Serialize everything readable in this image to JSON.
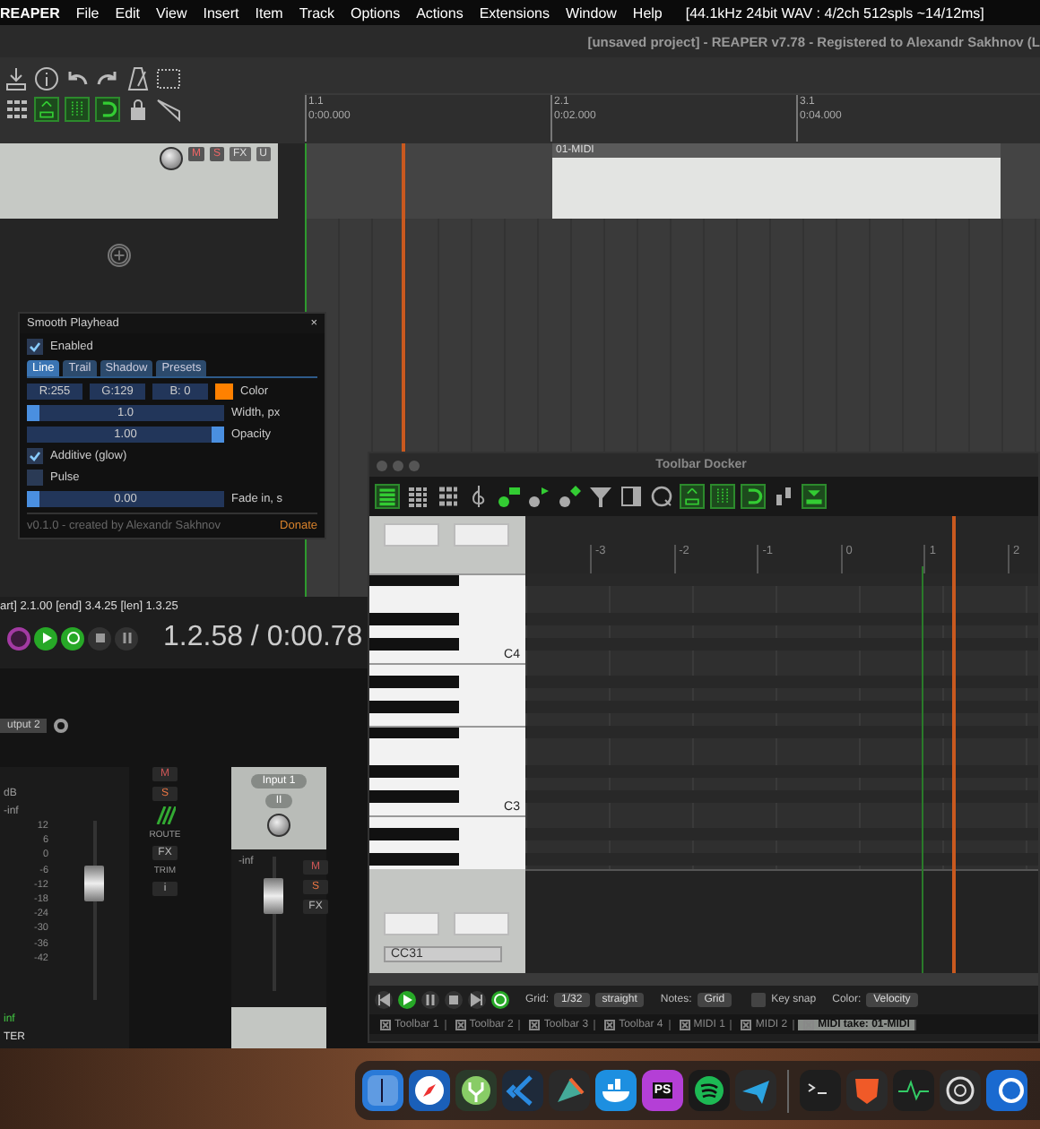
{
  "menubar": {
    "app": "REAPER",
    "items": [
      "File",
      "Edit",
      "View",
      "Insert",
      "Item",
      "Track",
      "Options",
      "Actions",
      "Extensions",
      "Window",
      "Help"
    ],
    "status": "[44.1kHz 24bit WAV : 4/2ch 512spls ~14/12ms]"
  },
  "main_window": {
    "title": "[unsaved project] - REAPER v7.78 - Registered to Alexandr Sakhnov (L",
    "ruler": [
      {
        "bar": "1.1",
        "time": "0:00.000"
      },
      {
        "bar": "2.1",
        "time": "0:02.000"
      },
      {
        "bar": "3.1",
        "time": "0:04.000"
      }
    ],
    "track": {
      "mute": "M",
      "solo": "S",
      "fx": "FX",
      "io": "U"
    },
    "item": {
      "name": "01-MIDI"
    },
    "transport": {
      "selection": "art] 2.1.00 [end] 3.4.25 [len] 1.3.25",
      "position": "1.2.58 / 0:00.78",
      "buttons": [
        {
          "kind": "record",
          "on": false
        },
        {
          "kind": "play",
          "on": true
        },
        {
          "kind": "repeat",
          "on": true
        },
        {
          "kind": "stop",
          "on": false
        },
        {
          "kind": "pause",
          "on": false
        }
      ]
    },
    "mixer": {
      "output": "utput 2",
      "master": {
        "unit": "dB",
        "peak": "-inf",
        "scale": [
          "12",
          "6",
          "0",
          "-6",
          "-12",
          "-18",
          "-24",
          "-30",
          "-36",
          "-42"
        ],
        "volume": "inf",
        "name": "TER"
      },
      "master_buttons": {
        "mute": "M",
        "solo": "S",
        "route": "ROUTE",
        "fx": "FX",
        "trim": "TRIM",
        "info": "i"
      },
      "input_strip": {
        "input": "Input 1",
        "channels": "II",
        "peak": "-inf",
        "mute": "M",
        "solo": "S",
        "fx": "FX"
      }
    }
  },
  "smooth_playhead": {
    "title": "Smooth Playhead",
    "close": "×",
    "enabled": {
      "label": "Enabled",
      "checked": true
    },
    "tabs": [
      {
        "label": "Line",
        "selected": true
      },
      {
        "label": "Trail",
        "selected": false
      },
      {
        "label": "Shadow",
        "selected": false
      },
      {
        "label": "Presets",
        "selected": false
      }
    ],
    "color_fields": [
      "R:255",
      "G:129",
      "B: 0"
    ],
    "color": "#ff8100",
    "color_label": "Color",
    "width": {
      "value": "1.0",
      "label": "Width, px",
      "level": 0.0
    },
    "opacity": {
      "value": "1.00",
      "label": "Opacity",
      "level": 1.0
    },
    "additive": {
      "label": "Additive (glow)",
      "checked": true
    },
    "pulse": {
      "label": "Pulse",
      "checked": false
    },
    "fade_in": {
      "value": "0.00",
      "label": "Fade in, s",
      "level": 0.0
    },
    "footer": "v0.1.0 - created by Alexandr Sakhnov",
    "donate": "Donate"
  },
  "midi_editor": {
    "title": "Toolbar Docker",
    "ruler": [
      "-3",
      "-2",
      "-1",
      "0",
      "1",
      "2"
    ],
    "key_labels": [
      "C4",
      "C3"
    ],
    "cc_lane": "CC31",
    "transport": [
      {
        "kind": "start",
        "on": false
      },
      {
        "kind": "play",
        "on": true
      },
      {
        "kind": "pause",
        "on": false
      },
      {
        "kind": "stop",
        "on": false
      },
      {
        "kind": "end",
        "on": false
      },
      {
        "kind": "repeat",
        "on": true
      }
    ],
    "grid_label": "Grid:",
    "grid": "1/32",
    "grid_type": "straight",
    "notes_label": "Notes:",
    "notes": "Grid",
    "key_snap": {
      "label": "Key snap",
      "checked": false
    },
    "color_label": "Color:",
    "color_mode": "Velocity"
  },
  "docker_tabs": [
    {
      "label": "Toolbar 1",
      "selected": false
    },
    {
      "label": "Toolbar 2",
      "selected": false
    },
    {
      "label": "Toolbar 3",
      "selected": false
    },
    {
      "label": "Toolbar 4",
      "selected": false
    },
    {
      "label": "MIDI 1",
      "selected": false
    },
    {
      "label": "MIDI 2",
      "selected": false
    },
    {
      "label": "MIDI take: 01-MIDI",
      "selected": true
    }
  ],
  "dock": [
    {
      "kind": "finder"
    },
    {
      "kind": "compass"
    },
    {
      "kind": "fork"
    },
    {
      "kind": "code"
    },
    {
      "kind": "wedge"
    },
    {
      "kind": "whale"
    },
    {
      "kind": "ps",
      "label": "PS"
    },
    {
      "kind": "waves"
    },
    {
      "kind": "plane"
    },
    {
      "kind": "terminal"
    },
    {
      "kind": "lion"
    },
    {
      "kind": "pulse"
    },
    {
      "kind": "knot"
    },
    {
      "kind": "ring"
    }
  ]
}
